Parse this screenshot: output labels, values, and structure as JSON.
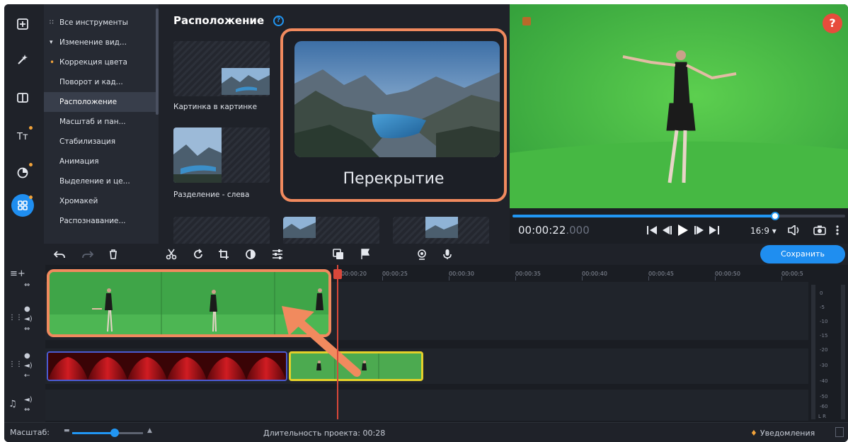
{
  "colors": {
    "accent": "#1f8ef0",
    "highlight": "#f18a5e",
    "playhead": "#d9473a",
    "chroma_green": "#3fae47",
    "badge": "#f2a33a",
    "help": "#e74c3c"
  },
  "rail": {
    "items": [
      {
        "icon": "import-icon",
        "dot": false
      },
      {
        "icon": "magic-wand-icon",
        "dot": false
      },
      {
        "icon": "transitions-icon",
        "dot": false
      },
      {
        "icon": "titles-icon",
        "dot": true
      },
      {
        "icon": "stickers-icon",
        "dot": true
      },
      {
        "icon": "more-tools-icon",
        "dot": true,
        "active": true
      }
    ]
  },
  "categories": {
    "items": [
      {
        "label": "Все инструменты",
        "lead": "grid"
      },
      {
        "label": "Изменение вид...",
        "lead": "chevron"
      },
      {
        "label": "Коррекция цвета",
        "lead": "dot"
      },
      {
        "label": "Поворот и кад...",
        "lead": ""
      },
      {
        "label": "Расположение",
        "lead": "",
        "active": true
      },
      {
        "label": "Масштаб и пан...",
        "lead": ""
      },
      {
        "label": "Стабилизация",
        "lead": ""
      },
      {
        "label": "Анимация",
        "lead": ""
      },
      {
        "label": "Выделение и це...",
        "lead": ""
      },
      {
        "label": "Хромакей",
        "lead": ""
      },
      {
        "label": "Распознавание...",
        "lead": ""
      }
    ]
  },
  "presets": {
    "title": "Расположение",
    "pip_label": "Картинка в картинке",
    "split_label": "Разделение - слева",
    "overlay_label": "Перекрытие"
  },
  "player": {
    "timecode_main": "00:00:22",
    "timecode_ms": ".000",
    "aspect": "16:9",
    "help": "?",
    "progress": 0.79
  },
  "toolbar": {
    "save_label": "Сохранить"
  },
  "timeline": {
    "ticks": [
      "00:00:20",
      "00:00:25",
      "00:00:30",
      "00:00:35",
      "00:00:40",
      "00:00:45",
      "00:00:50",
      "00:00:5"
    ],
    "meter_labels": [
      "0",
      "-5",
      "-10",
      "-15",
      "-20",
      "-30",
      "-40",
      "-50",
      "-60"
    ],
    "meter_lr": "L  R"
  },
  "status": {
    "zoom_label": "Масштаб:",
    "zoom_value": 0.6,
    "duration": "Длительность проекта: 00:28",
    "notifications": "Уведомления"
  }
}
